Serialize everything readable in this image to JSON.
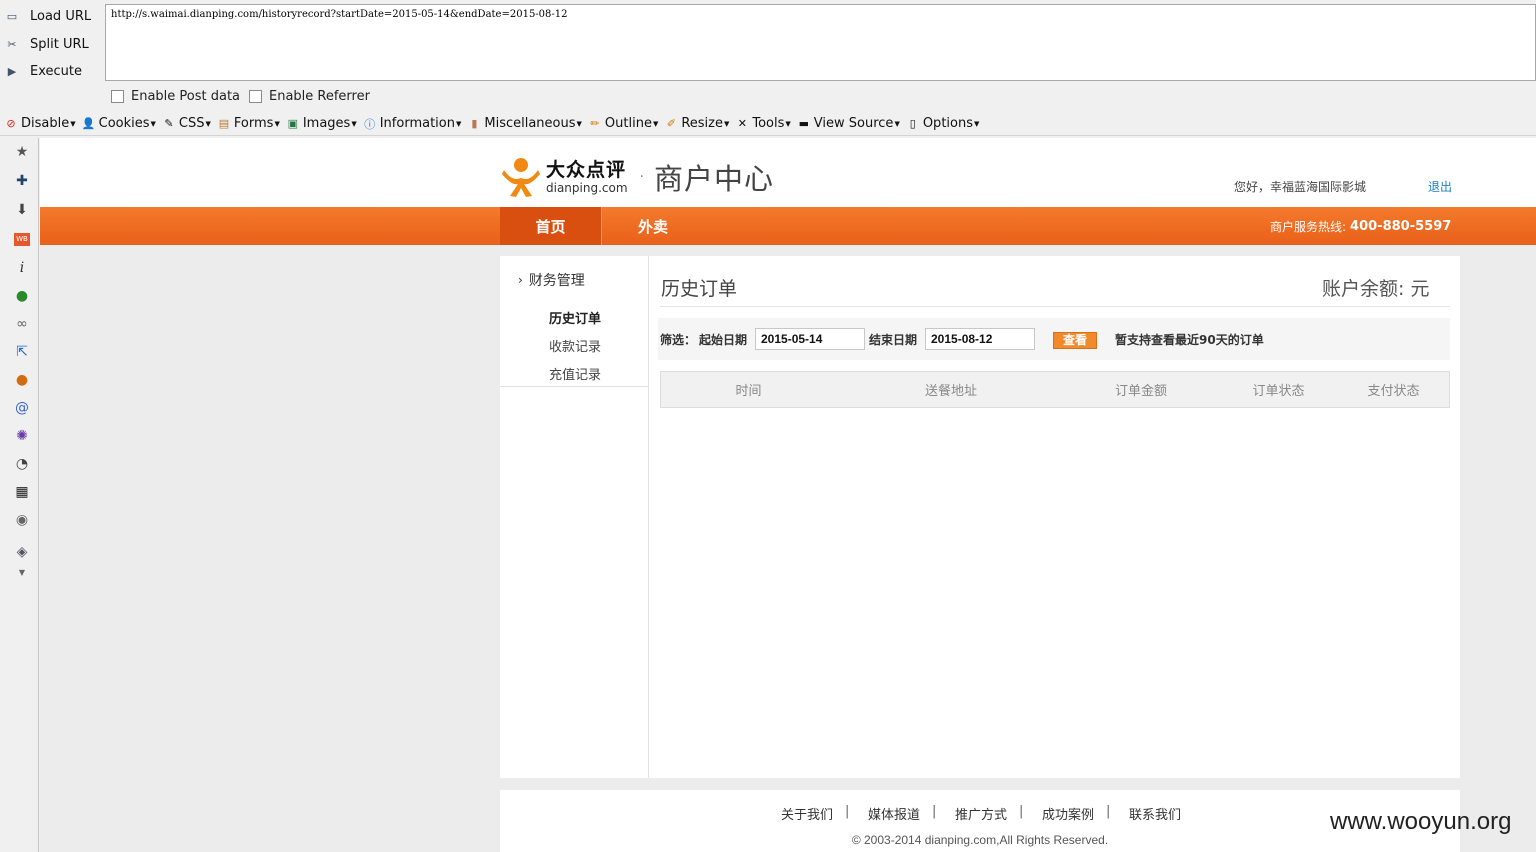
{
  "hackbar": {
    "load_url": "Load URL",
    "split_url": "Split URL",
    "execute": "Execute",
    "url_value": "http://s.waimai.dianping.com/historyrecord?startDate=2015-05-14&endDate=2015-08-12",
    "enable_post": "Enable Post data",
    "enable_referrer": "Enable Referrer"
  },
  "webdev_toolbar": {
    "items": [
      "Disable",
      "Cookies",
      "CSS",
      "Forms",
      "Images",
      "Information",
      "Miscellaneous",
      "Outline",
      "Resize",
      "Tools",
      "View Source",
      "Options"
    ]
  },
  "header": {
    "logo_cn": "大众点评",
    "logo_en": "dianping.com",
    "title": "商户中心",
    "greeting": "您好，幸福蓝海国际影城",
    "logout": "退出"
  },
  "nav": {
    "tabs": [
      "首页",
      "外卖"
    ],
    "hotline_label": "商户服务热线:",
    "hotline_number": "400-880-5597"
  },
  "menu": {
    "section": "财务管理",
    "items": [
      "历史订单",
      "收款记录",
      "充值记录"
    ]
  },
  "content": {
    "title": "历史订单",
    "balance": "账户余额: 元",
    "filter_label": "筛选：",
    "start_label": "起始日期",
    "start_value": "2015-05-14",
    "end_label": "结束日期",
    "end_value": "2015-08-12",
    "query_button": "查看",
    "notice": "暂支持查看最近90天的订单",
    "columns": [
      "时间",
      "送餐地址",
      "订单金额",
      "订单状态",
      "支付状态"
    ]
  },
  "footer": {
    "links": [
      "关于我们",
      "媒体报道",
      "推广方式",
      "成功案例",
      "联系我们"
    ],
    "separator": "|",
    "copyright": "© 2003-2014 dianping.com,All Rights Reserved."
  },
  "watermark": "www.wooyun.org",
  "colors": {
    "nav_orange": "#f06d24",
    "button_orange": "#f08a2a",
    "link_blue": "#1a7fc1"
  }
}
